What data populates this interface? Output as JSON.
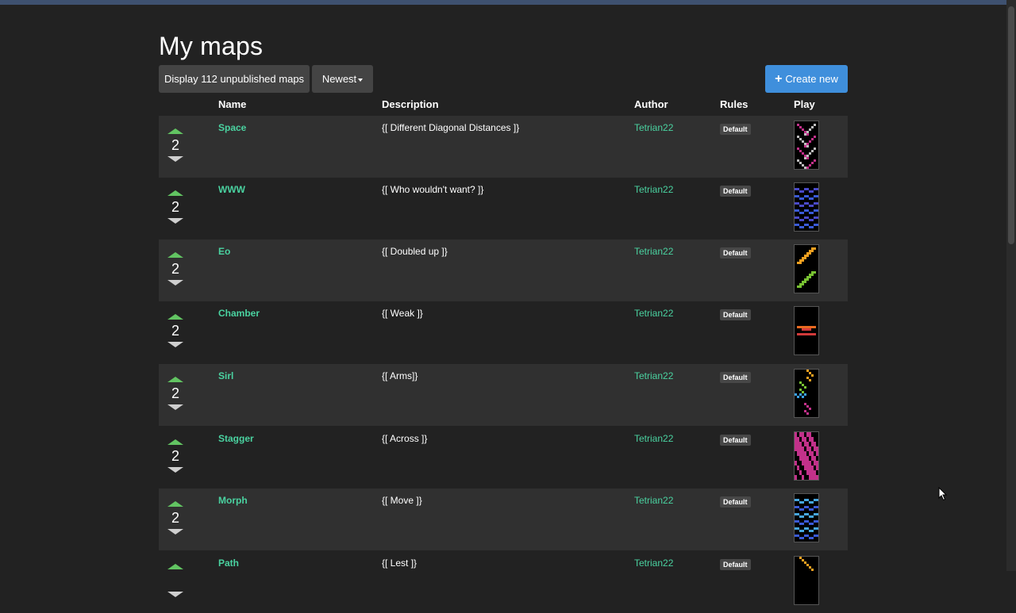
{
  "page": {
    "title": "My maps"
  },
  "toolbar": {
    "unpublished_label": "Display 112 unpublished maps",
    "sort_label": "Newest",
    "create_label": "Create new"
  },
  "table": {
    "headers": {
      "name": "Name",
      "description": "Description",
      "author": "Author",
      "rules": "Rules",
      "play": "Play"
    },
    "rows": [
      {
        "score": "2",
        "name": "Space",
        "description": "{[ Different Diagonal Distances ]}",
        "author": "Tetrian22",
        "rules": "Default",
        "thumb_colors": [
          "#c2318a",
          "#bdbdbd"
        ]
      },
      {
        "score": "2",
        "name": "WWW",
        "description": "{[ Who wouldn't want? ]}",
        "author": "Tetrian22",
        "rules": "Default",
        "thumb_colors": [
          "#3a5ad8",
          "#4a4ac8"
        ]
      },
      {
        "score": "2",
        "name": "Eo",
        "description": "{[ Doubled up ]}",
        "author": "Tetrian22",
        "rules": "Default",
        "thumb_colors": [
          "#f0a020",
          "#78c232"
        ]
      },
      {
        "score": "2",
        "name": "Chamber",
        "description": "{[ Weak ]}",
        "author": "Tetrian22",
        "rules": "Default",
        "thumb_colors": [
          "#e86a20",
          "#d23a3a"
        ]
      },
      {
        "score": "2",
        "name": "Sirl",
        "description": "{[ Arms]}",
        "author": "Tetrian22",
        "rules": "Default",
        "thumb_colors": [
          "#f0a020",
          "#78c232",
          "#3aa0e8",
          "#c2318a"
        ]
      },
      {
        "score": "2",
        "name": "Stagger",
        "description": "{[ Across ]}",
        "author": "Tetrian22",
        "rules": "Default",
        "thumb_colors": [
          "#c2318a",
          "#bdbdbd"
        ]
      },
      {
        "score": "2",
        "name": "Morph",
        "description": "{[ Move ]}",
        "author": "Tetrian22",
        "rules": "Default",
        "thumb_colors": [
          "#3a5ad8",
          "#46a6e0"
        ]
      },
      {
        "score": "",
        "name": "Path",
        "description": "{[ Lest ]}",
        "author": "Tetrian22",
        "rules": "Default",
        "thumb_colors": [
          "#f0a020"
        ]
      }
    ]
  }
}
